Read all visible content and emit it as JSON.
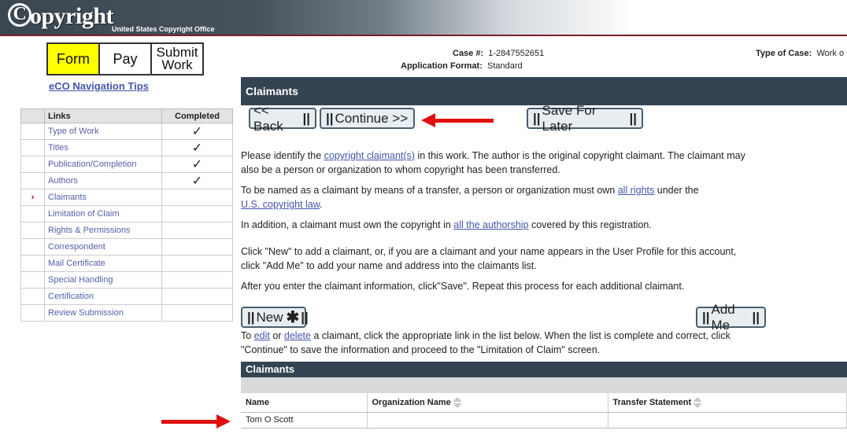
{
  "header": {
    "logo_text": "opyright",
    "logo_c": "C",
    "logo_sub": "United States Copyright Office"
  },
  "steps": {
    "form": "Form",
    "pay": "Pay",
    "submit_line1": "Submit",
    "submit_line2": "Work"
  },
  "nav_tips": "eCO Navigation Tips",
  "links_table": {
    "col_links": "Links",
    "col_completed": "Completed",
    "current_marker": "›",
    "check_mark": "✓",
    "rows": [
      {
        "label": "Type of Work",
        "completed": true
      },
      {
        "label": "Titles",
        "completed": true
      },
      {
        "label": "Publication/Completion",
        "completed": true
      },
      {
        "label": "Authors",
        "completed": true
      },
      {
        "label": "Claimants",
        "completed": false,
        "current": true
      },
      {
        "label": "Limitation of Claim",
        "completed": false
      },
      {
        "label": "Rights & Permissions",
        "completed": false
      },
      {
        "label": "Correspondent",
        "completed": false
      },
      {
        "label": "Mail Certificate",
        "completed": false
      },
      {
        "label": "Special Handling",
        "completed": false
      },
      {
        "label": "Certification",
        "completed": false
      },
      {
        "label": "Review Submission",
        "completed": false
      }
    ]
  },
  "case": {
    "case_label": "Case #:",
    "case_value": "1-2847552651",
    "format_label": "Application Format:",
    "format_value": "Standard",
    "type_label": "Type of Case:",
    "type_value": "Work o"
  },
  "section_title": "Claimants",
  "buttons": {
    "back": "<< Back",
    "continue": "Continue >>",
    "save_later": "Save For Later",
    "new": "New",
    "add_me": "Add Me"
  },
  "text": {
    "p1_a": "Please identify the ",
    "p1_link": "copyright claimant(s)",
    "p1_b": " in this work. The author is the original copyright claimant. The claimant may",
    "p1_c": "also be a person or organization to whom copyright has been transferred.",
    "p2_a": "To be named as a claimant by means of a transfer, a person or organization must own ",
    "p2_link": "all rights",
    "p2_b": " under the",
    "p2_link2": "U.S. copyright law",
    "p2_c": ".",
    "p3_a": "In addition, a claimant must own the copyright in ",
    "p3_link": "all the authorship",
    "p3_b": " covered by this registration.",
    "p4_a": "Click \"New\" to add a claimant, or, if you are a claimant and your name appears in the User Profile for this account,",
    "p4_b": "click \"Add Me\" to add your name and address into the claimants list.",
    "p5": "After you enter the claimant information, click\"Save\". Repeat this process for each additional claimant.",
    "p6_a": "To ",
    "p6_edit": "edit",
    "p6_b": " or ",
    "p6_delete": "delete",
    "p6_c": " a claimant, click the appropriate link in the list below. When the list is complete and correct, click",
    "p6_d": "\"Continue\" to save the information and proceed to the \"Limitation of Claim\" screen."
  },
  "claimants_table": {
    "title": "Claimants",
    "col_name": "Name",
    "col_org": "Organization Name",
    "col_transfer": "Transfer Statement",
    "rows": [
      {
        "name": "Tom O Scott",
        "org": "",
        "transfer": ""
      }
    ]
  },
  "colors": {
    "header_dark": "#344452",
    "active_step": "#ffff00",
    "annotation_arrow": "#e01010",
    "link": "#4455aa"
  }
}
